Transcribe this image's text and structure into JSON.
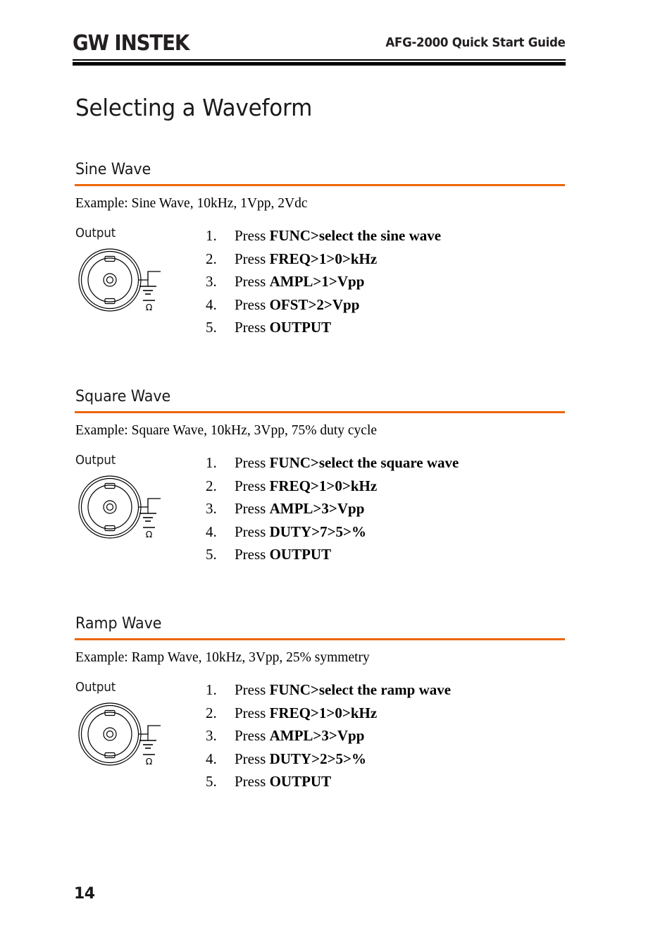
{
  "header": {
    "logo_text_part1": "G",
    "logo_text_part2": "W",
    "logo_text_part3": " INSTEK",
    "logo_name": "GW INSTEK",
    "title": "AFG-2000 Quick Start Guide"
  },
  "page_title": "Selecting a Waveform",
  "colors": {
    "accent_orange": "#ec6608",
    "rule_black": "#000000",
    "text_black": "#1a1a1a"
  },
  "sections": [
    {
      "heading": "Sine Wave",
      "example": "Example: Sine Wave, 10kHz, 1Vpp, 2Vdc",
      "output_label": "Output",
      "icon_label": "Ω",
      "steps": [
        {
          "num": "1.",
          "lead": "Press ",
          "key": "FUNC>select the sine wave"
        },
        {
          "num": "2.",
          "lead": "Press ",
          "key": "FREQ>1>0>kHz"
        },
        {
          "num": "3.",
          "lead": "Press ",
          "key": "AMPL>1>Vpp"
        },
        {
          "num": "4.",
          "lead": "Press ",
          "key": "OFST>2>Vpp"
        },
        {
          "num": "5.",
          "lead": "Press ",
          "key": "OUTPUT"
        }
      ]
    },
    {
      "heading": "Square Wave",
      "example": "Example: Square Wave, 10kHz, 3Vpp, 75% duty cycle",
      "output_label": "Output",
      "icon_label": "Ω",
      "steps": [
        {
          "num": "1.",
          "lead": "Press ",
          "key": "FUNC>select the square wave"
        },
        {
          "num": "2.",
          "lead": "Press ",
          "key": "FREQ>1>0>kHz"
        },
        {
          "num": "3.",
          "lead": "Press ",
          "key": "AMPL>3>Vpp"
        },
        {
          "num": "4.",
          "lead": "Press ",
          "key": "DUTY>7>5>%"
        },
        {
          "num": "5.",
          "lead": "Press ",
          "key": "OUTPUT"
        }
      ]
    },
    {
      "heading": "Ramp Wave",
      "example": "Example: Ramp Wave, 10kHz, 3Vpp, 25% symmetry",
      "output_label": "Output",
      "icon_label": "Ω",
      "steps": [
        {
          "num": "1.",
          "lead": "Press ",
          "key": "FUNC>select the ramp wave"
        },
        {
          "num": "2.",
          "lead": "Press ",
          "key": "FREQ>1>0>kHz"
        },
        {
          "num": "3.",
          "lead": "Press ",
          "key": "AMPL>3>Vpp"
        },
        {
          "num": "4.",
          "lead": "Press ",
          "key": "DUTY>2>5>%"
        },
        {
          "num": "5.",
          "lead": "Press ",
          "key": "OUTPUT"
        }
      ]
    }
  ],
  "footer": {
    "page_number": "14"
  }
}
